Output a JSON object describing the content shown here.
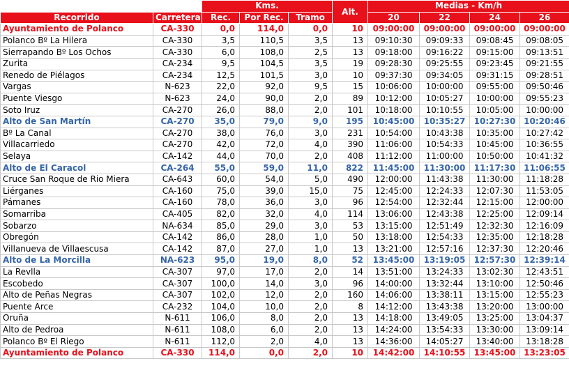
{
  "header": {
    "kms_group": "Kms.",
    "alt_group": "Alt.",
    "medias_group": "Medias - Km/h",
    "col_recorrido": "Recorrido",
    "col_carretera": "Carretera",
    "col_rec": "Rec.",
    "col_por_rec": "Por Rec.",
    "col_tramo": "Tramo",
    "speeds": [
      "20",
      "22",
      "24",
      "26"
    ]
  },
  "rows": [
    {
      "name": "Ayuntamiento de Polanco",
      "road": "CA-330",
      "rec": "0,0",
      "por": "114,0",
      "tramo": "0,0",
      "alt": "10",
      "t": [
        "09:00:00",
        "09:00:00",
        "09:00:00",
        "09:00:00"
      ],
      "kind": "start"
    },
    {
      "name": "Polanco Bº La Hilera",
      "road": "CA-330",
      "rec": "3,5",
      "por": "110,5",
      "tramo": "3,5",
      "alt": "13",
      "t": [
        "09:10:30",
        "09:09:33",
        "09:08:45",
        "09:08:05"
      ],
      "kind": "normal"
    },
    {
      "name": "Sierrapando Bº Los Ochos",
      "road": "CA-330",
      "rec": "6,0",
      "por": "108,0",
      "tramo": "2,5",
      "alt": "13",
      "t": [
        "09:18:00",
        "09:16:22",
        "09:15:00",
        "09:13:51"
      ],
      "kind": "normal"
    },
    {
      "name": "Zurita",
      "road": "CA-234",
      "rec": "9,5",
      "por": "104,5",
      "tramo": "3,5",
      "alt": "19",
      "t": [
        "09:28:30",
        "09:25:55",
        "09:23:45",
        "09:21:55"
      ],
      "kind": "normal"
    },
    {
      "name": "Renedo de Piélagos",
      "road": "CA-234",
      "rec": "12,5",
      "por": "101,5",
      "tramo": "3,0",
      "alt": "10",
      "t": [
        "09:37:30",
        "09:34:05",
        "09:31:15",
        "09:28:51"
      ],
      "kind": "normal"
    },
    {
      "name": "Vargas",
      "road": "N-623",
      "rec": "22,0",
      "por": "92,0",
      "tramo": "9,5",
      "alt": "15",
      "t": [
        "10:06:00",
        "10:00:00",
        "09:55:00",
        "09:50:46"
      ],
      "kind": "normal"
    },
    {
      "name": "Puente Viesgo",
      "road": "N-623",
      "rec": "24,0",
      "por": "90,0",
      "tramo": "2,0",
      "alt": "89",
      "t": [
        "10:12:00",
        "10:05:27",
        "10:00:00",
        "09:55:23"
      ],
      "kind": "normal"
    },
    {
      "name": "Soto Iruz",
      "road": "CA-270",
      "rec": "26,0",
      "por": "88,0",
      "tramo": "2,0",
      "alt": "101",
      "t": [
        "10:18:00",
        "10:10:55",
        "10:05:00",
        "10:00:00"
      ],
      "kind": "normal"
    },
    {
      "name": "Alto de San Martín",
      "road": "CA-270",
      "rec": "35,0",
      "por": "79,0",
      "tramo": "9,0",
      "alt": "195",
      "t": [
        "10:45:00",
        "10:35:27",
        "10:27:30",
        "10:20:46"
      ],
      "kind": "peak"
    },
    {
      "name": "Bº La Canal",
      "road": "CA-270",
      "rec": "38,0",
      "por": "76,0",
      "tramo": "3,0",
      "alt": "231",
      "t": [
        "10:54:00",
        "10:43:38",
        "10:35:00",
        "10:27:42"
      ],
      "kind": "normal"
    },
    {
      "name": "Villacarriedo",
      "road": "CA-270",
      "rec": "42,0",
      "por": "72,0",
      "tramo": "4,0",
      "alt": "390",
      "t": [
        "11:06:00",
        "10:54:33",
        "10:45:00",
        "10:36:55"
      ],
      "kind": "normal"
    },
    {
      "name": "Selaya",
      "road": "CA-142",
      "rec": "44,0",
      "por": "70,0",
      "tramo": "2,0",
      "alt": "408",
      "t": [
        "11:12:00",
        "11:00:00",
        "10:50:00",
        "10:41:32"
      ],
      "kind": "normal"
    },
    {
      "name": "Alto de El Caracol",
      "road": "CA-264",
      "rec": "55,0",
      "por": "59,0",
      "tramo": "11,0",
      "alt": "822",
      "t": [
        "11:45:00",
        "11:30:00",
        "11:17:30",
        "11:06:55"
      ],
      "kind": "peak"
    },
    {
      "name": "Cruce San Roque de Rio Miera",
      "road": "CA-643",
      "rec": "60,0",
      "por": "54,0",
      "tramo": "5,0",
      "alt": "490",
      "t": [
        "12:00:00",
        "11:43:38",
        "11:30:00",
        "11:18:28"
      ],
      "kind": "normal"
    },
    {
      "name": "Liérganes",
      "road": "CA-160",
      "rec": "75,0",
      "por": "39,0",
      "tramo": "15,0",
      "alt": "75",
      "t": [
        "12:45:00",
        "12:24:33",
        "12:07:30",
        "11:53:05"
      ],
      "kind": "normal"
    },
    {
      "name": "Pámanes",
      "road": "CA-160",
      "rec": "78,0",
      "por": "36,0",
      "tramo": "3,0",
      "alt": "96",
      "t": [
        "12:54:00",
        "12:32:44",
        "12:15:00",
        "12:00:00"
      ],
      "kind": "normal"
    },
    {
      "name": "Somarriba",
      "road": "CA-405",
      "rec": "82,0",
      "por": "32,0",
      "tramo": "4,0",
      "alt": "114",
      "t": [
        "13:06:00",
        "12:43:38",
        "12:25:00",
        "12:09:14"
      ],
      "kind": "normal"
    },
    {
      "name": "Sobarzo",
      "road": "NA-634",
      "rec": "85,0",
      "por": "29,0",
      "tramo": "3,0",
      "alt": "53",
      "t": [
        "13:15:00",
        "12:51:49",
        "12:32:30",
        "12:16:09"
      ],
      "kind": "normal"
    },
    {
      "name": "Obregón",
      "road": "CA-142",
      "rec": "86,0",
      "por": "28,0",
      "tramo": "1,0",
      "alt": "50",
      "t": [
        "13:18:00",
        "12:54:33",
        "12:35:00",
        "12:18:28"
      ],
      "kind": "normal"
    },
    {
      "name": "Villanueva de Villaescusa",
      "road": "CA-142",
      "rec": "87,0",
      "por": "27,0",
      "tramo": "1,0",
      "alt": "13",
      "t": [
        "13:21:00",
        "12:57:16",
        "12:37:30",
        "12:20:46"
      ],
      "kind": "normal"
    },
    {
      "name": "Alto de La Morcilla",
      "road": "NA-623",
      "rec": "95,0",
      "por": "19,0",
      "tramo": "8,0",
      "alt": "52",
      "t": [
        "13:45:00",
        "13:19:05",
        "12:57:30",
        "12:39:14"
      ],
      "kind": "peak"
    },
    {
      "name": "La Revlla",
      "road": "CA-307",
      "rec": "97,0",
      "por": "17,0",
      "tramo": "2,0",
      "alt": "14",
      "t": [
        "13:51:00",
        "13:24:33",
        "13:02:30",
        "12:43:51"
      ],
      "kind": "normal"
    },
    {
      "name": "Escobedo",
      "road": "CA-307",
      "rec": "100,0",
      "por": "14,0",
      "tramo": "3,0",
      "alt": "96",
      "t": [
        "14:00:00",
        "13:32:44",
        "13:10:00",
        "12:50:46"
      ],
      "kind": "normal"
    },
    {
      "name": "Alto de Peñas Negras",
      "road": "CA-307",
      "rec": "102,0",
      "por": "12,0",
      "tramo": "2,0",
      "alt": "160",
      "t": [
        "14:06:00",
        "13:38:11",
        "13:15:00",
        "12:55:23"
      ],
      "kind": "normal"
    },
    {
      "name": "Puente Arce",
      "road": "CA-232",
      "rec": "104,0",
      "por": "10,0",
      "tramo": "2,0",
      "alt": "8",
      "t": [
        "14:12:00",
        "13:43:38",
        "13:20:00",
        "13:00:00"
      ],
      "kind": "normal"
    },
    {
      "name": "Oruña",
      "road": "N-611",
      "rec": "106,0",
      "por": "8,0",
      "tramo": "2,0",
      "alt": "13",
      "t": [
        "14:18:00",
        "13:49:05",
        "13:25:00",
        "13:04:37"
      ],
      "kind": "normal"
    },
    {
      "name": "Alto de Pedroa",
      "road": "N-611",
      "rec": "108,0",
      "por": "6,0",
      "tramo": "2,0",
      "alt": "13",
      "t": [
        "14:24:00",
        "13:54:33",
        "13:30:00",
        "13:09:14"
      ],
      "kind": "normal"
    },
    {
      "name": "Polanco  Bº El Riego",
      "road": "N-611",
      "rec": "112,0",
      "por": "2,0",
      "tramo": "4,0",
      "alt": "13",
      "t": [
        "14:36:00",
        "14:05:27",
        "13:40:00",
        "13:18:28"
      ],
      "kind": "normal"
    },
    {
      "name": "Ayuntamiento de Polanco",
      "road": "CA-330",
      "rec": "114,0",
      "por": "0,0",
      "tramo": "2,0",
      "alt": "10",
      "t": [
        "14:42:00",
        "14:10:55",
        "13:45:00",
        "13:23:05"
      ],
      "kind": "start"
    }
  ]
}
